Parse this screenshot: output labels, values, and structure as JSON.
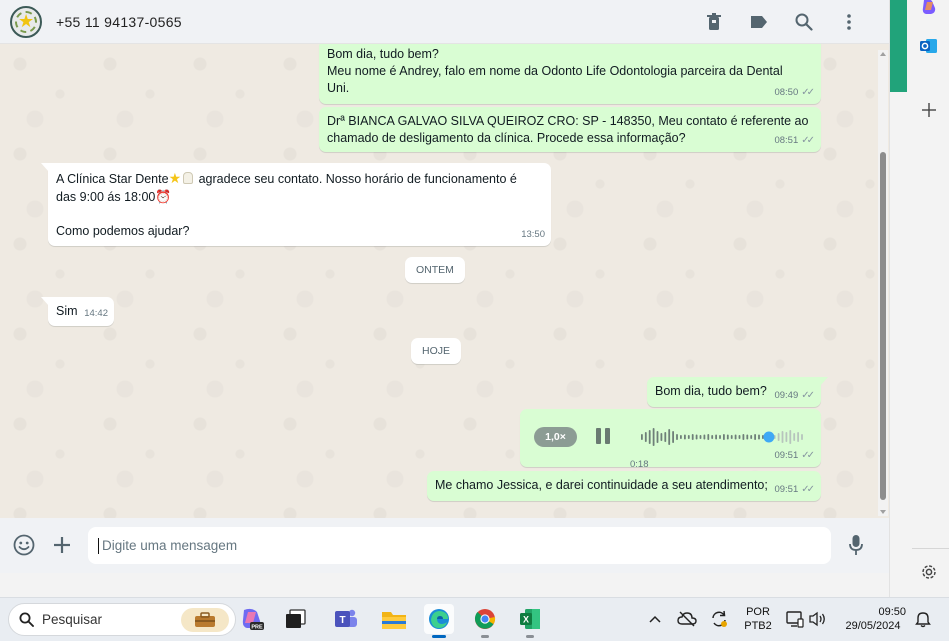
{
  "header": {
    "contact": "+55 11 94137-0565",
    "icons": [
      "delete-icon",
      "label-icon",
      "search-icon",
      "more-icon"
    ]
  },
  "messages": {
    "m1": {
      "text": "Bom dia, tudo bem?\nMeu nome é Andrey, falo em nome da Odonto Life Odontologia parceira da Dental\nUni.",
      "time": "08:50"
    },
    "m2": {
      "text": "Drª BIANCA GALVAO SILVA QUEIROZ CRO: SP - 148350, Meu contato é referente ao\nchamado de desligamento da clínica. Procede essa informação?",
      "time": "08:51"
    },
    "m3": {
      "line1": "A Clínica Star Dente",
      "line1b": " agradece seu contato. Nosso horário de funcionamento é",
      "line2": "das 9:00 ás 18:00",
      "line3": "Como podemos ajudar?",
      "time": "13:50"
    },
    "date1": "ONTEM",
    "m4": {
      "text": "Sim",
      "time": "14:42"
    },
    "date2": "HOJE",
    "m5": {
      "text": "Bom dia, tudo bem?",
      "time": "09:49"
    },
    "audio": {
      "speed": "1,0×",
      "duration": "0:18",
      "time": "09:51",
      "progress": 0.78
    },
    "m6": {
      "text": "Me chamo Jessica, e darei continuidade a seu atendimento;",
      "time": "09:51"
    }
  },
  "composer": {
    "placeholder": "Digite uma mensagem"
  },
  "taskbar": {
    "search_label": "Pesquisar",
    "language": "POR",
    "layout": "PTB2",
    "time": "09:50",
    "date": "29/05/2024"
  },
  "colors": {
    "outgoing": "#d9fdd3",
    "incoming": "#ffffff",
    "accent": "#21a37a"
  }
}
